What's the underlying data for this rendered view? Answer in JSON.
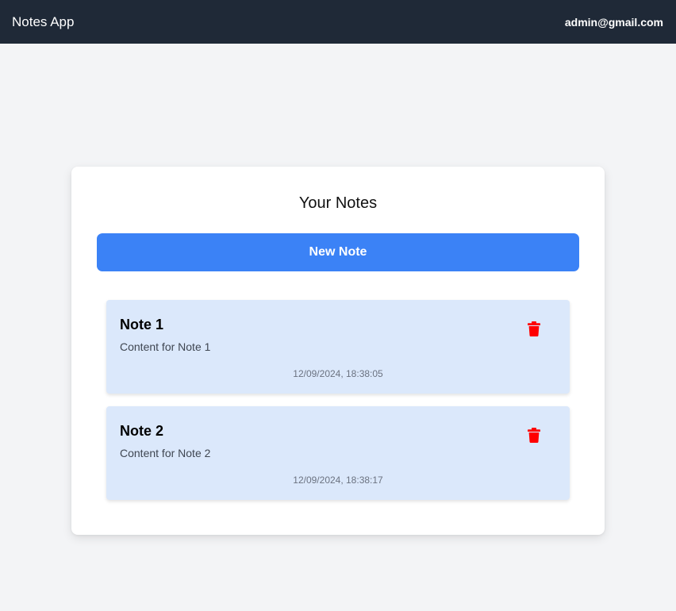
{
  "navbar": {
    "brand": "Notes App",
    "user_email": "admin@gmail.com"
  },
  "main": {
    "title": "Your Notes",
    "new_note_label": "New Note",
    "notes": [
      {
        "title": "Note 1",
        "content": "Content for Note 1",
        "timestamp": "12/09/2024, 18:38:05",
        "delete_icon": "trash-icon"
      },
      {
        "title": "Note 2",
        "content": "Content for Note 2",
        "timestamp": "12/09/2024, 18:38:17",
        "delete_icon": "trash-icon"
      }
    ]
  },
  "colors": {
    "navbar_bg": "#1f2937",
    "page_bg": "#f3f4f6",
    "primary_button": "#3b82f6",
    "note_bg": "#dbe8fb",
    "delete_icon": "#ff0000"
  }
}
